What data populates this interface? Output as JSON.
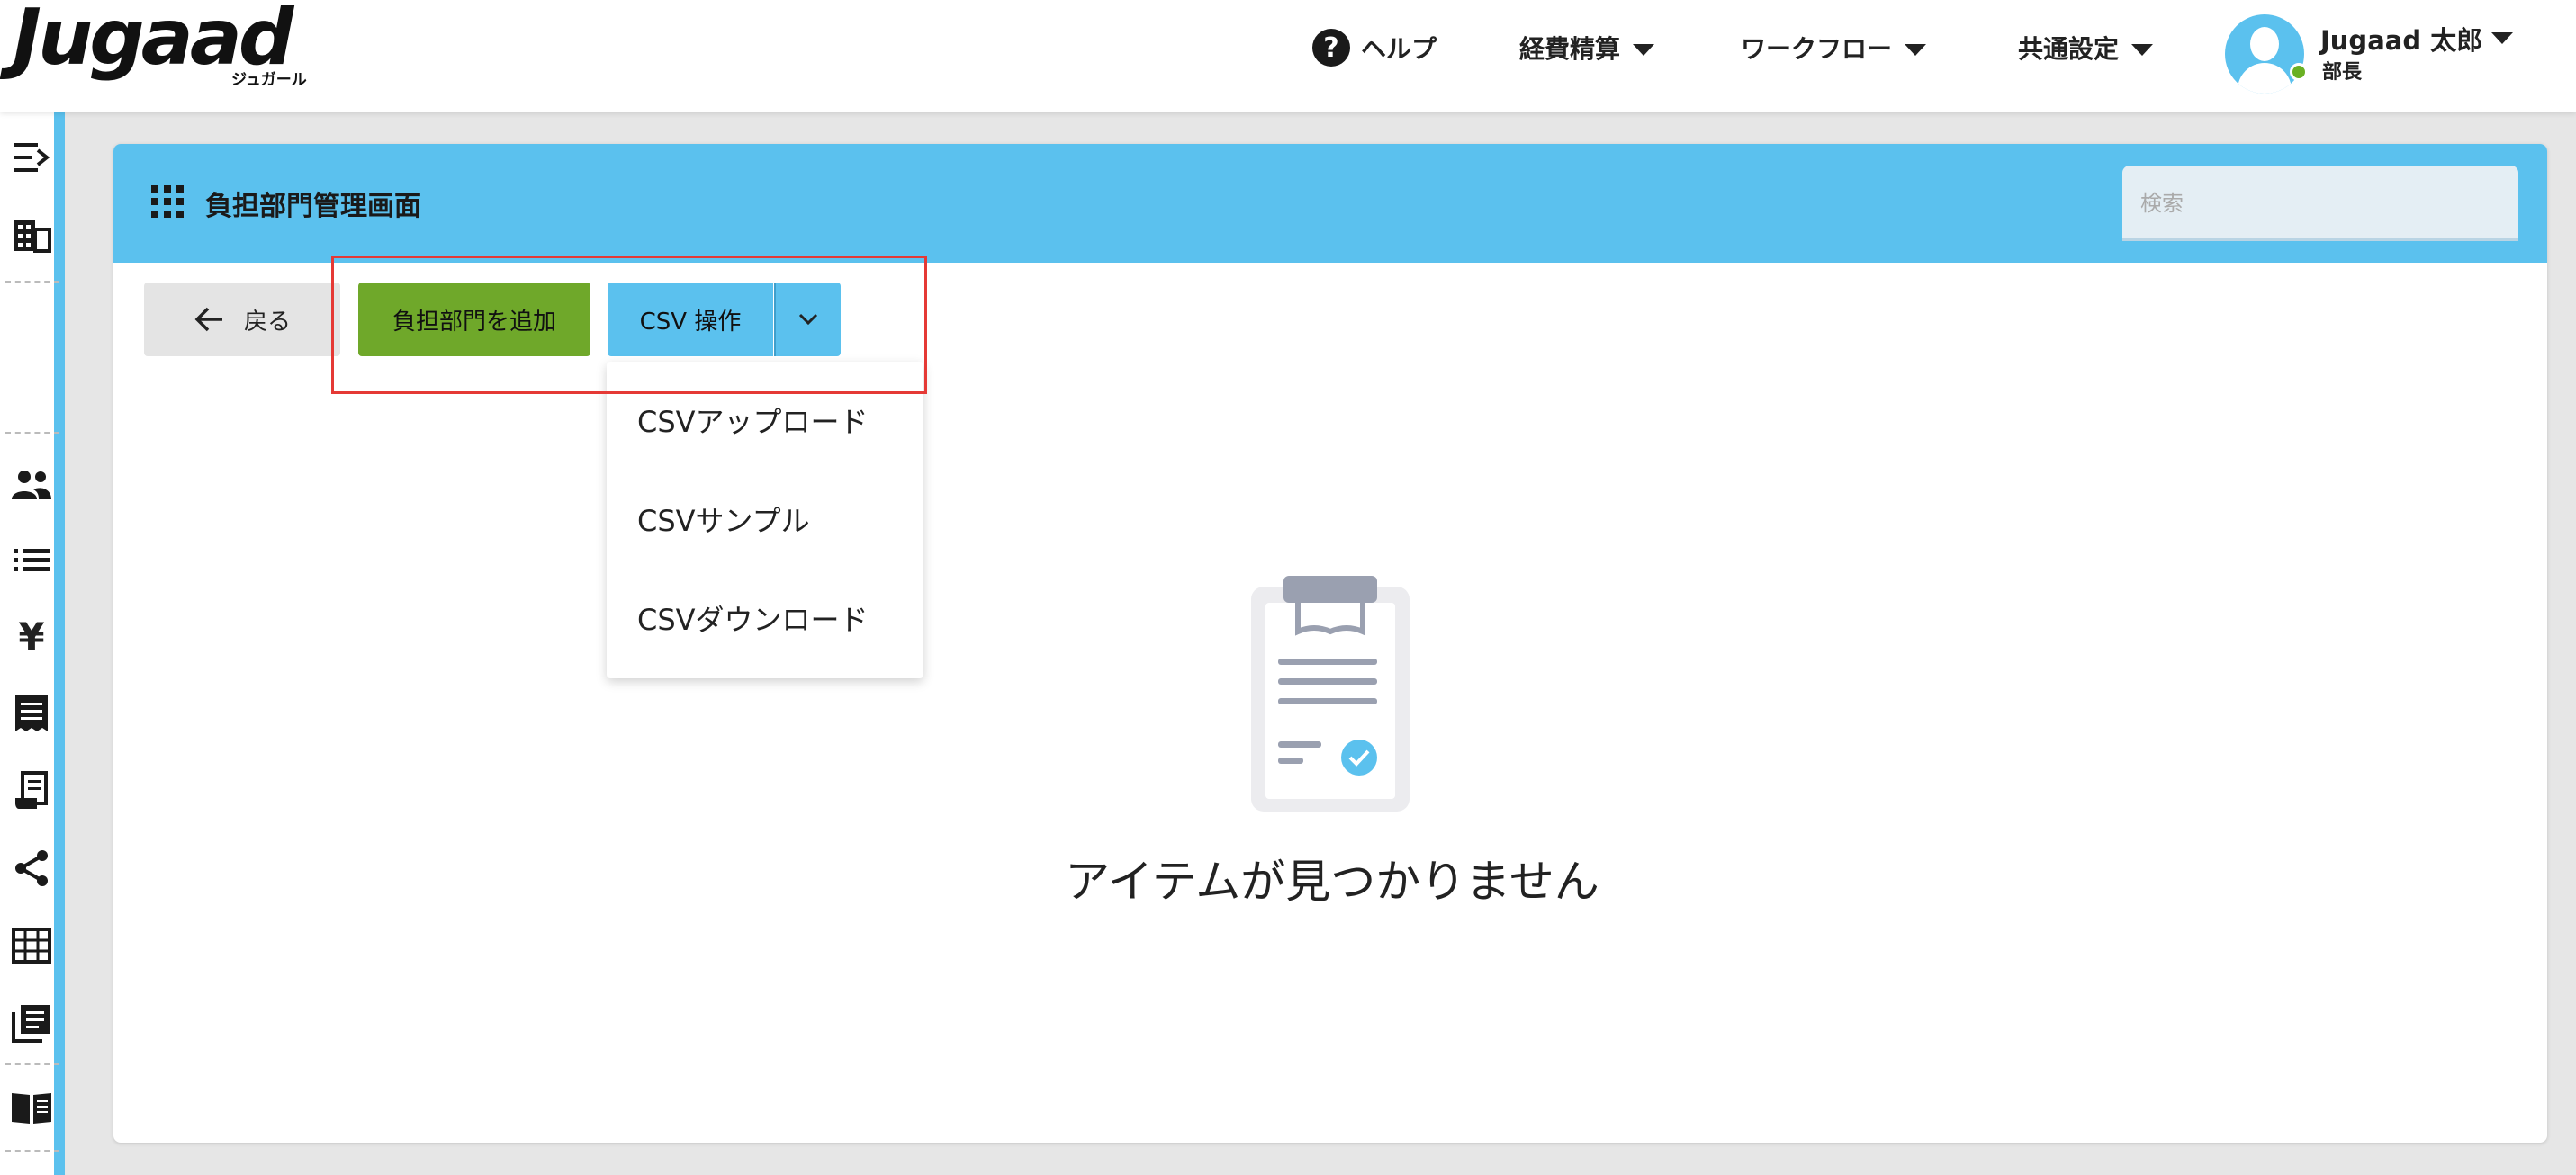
{
  "app": {
    "logo_text": "Jugaad",
    "logo_sub": "ジュガール"
  },
  "nav": {
    "help": "ヘルプ",
    "expense": "経費精算",
    "workflow": "ワークフロー",
    "settings": "共通設定"
  },
  "user": {
    "name": "Jugaad 太郎",
    "role": "部長"
  },
  "page": {
    "title": "負担部門管理画面",
    "search_placeholder": "検索"
  },
  "toolbar": {
    "back_label": "戻る",
    "add_label": "負担部門を追加",
    "csv_label": "CSV 操作"
  },
  "csv_menu": {
    "items": [
      "CSVアップロード",
      "CSVサンプル",
      "CSVダウンロード"
    ]
  },
  "empty_state": {
    "message": "アイテムが見つかりません"
  },
  "colors": {
    "accent": "#5bc1ee",
    "add_button": "#6fa82a",
    "highlight": "#e53935"
  }
}
